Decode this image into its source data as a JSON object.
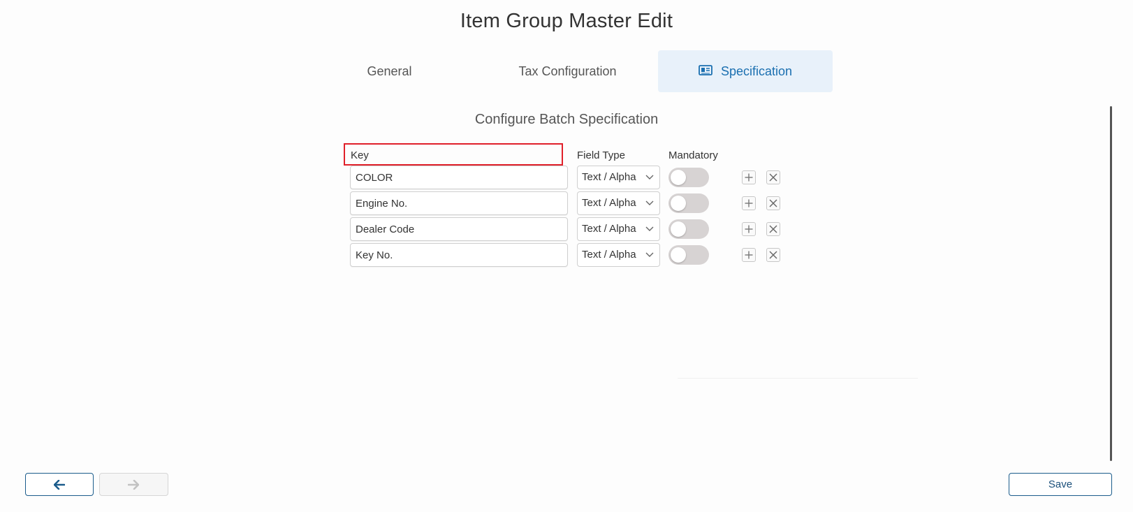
{
  "page": {
    "title": "Item Group Master Edit"
  },
  "tabs": [
    {
      "label": "General",
      "active": false
    },
    {
      "label": "Tax Configuration",
      "active": false
    },
    {
      "label": "Specification",
      "active": true,
      "icon": "id-card-icon"
    }
  ],
  "section": {
    "title": "Configure Batch Specification"
  },
  "columns": {
    "key": "Key",
    "field_type": "Field Type",
    "mandatory": "Mandatory"
  },
  "rows": [
    {
      "key": "COLOR",
      "field_type": "Text / Alpha",
      "mandatory": false
    },
    {
      "key": "Engine No.",
      "field_type": "Text / Alpha",
      "mandatory": false
    },
    {
      "key": "Dealer Code",
      "field_type": "Text / Alpha",
      "mandatory": false
    },
    {
      "key": "Key No.",
      "field_type": "Text / Alpha",
      "mandatory": false
    }
  ],
  "footer": {
    "back_icon": "arrow-left-icon",
    "forward_icon": "arrow-right-icon",
    "save_label": "Save"
  },
  "colors": {
    "accent": "#1a6fb0",
    "active_tab_bg": "#e8f1fa",
    "highlight_border": "#e0202a",
    "toggle_off": "#d7d3d3"
  }
}
